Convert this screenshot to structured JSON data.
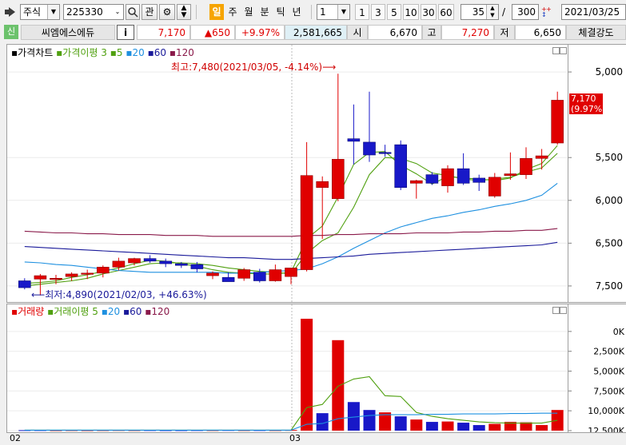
{
  "toolbar": {
    "market_type": "주식",
    "stock_code": "225330",
    "watch_label": "관",
    "period_buttons": [
      "일",
      "주",
      "월",
      "분",
      "틱",
      "년"
    ],
    "interval_value": "1",
    "interval_presets": [
      "1",
      "3",
      "5",
      "10",
      "30",
      "60"
    ],
    "zoom_count": "35",
    "zoom_total": "300",
    "date": "2021/03/25"
  },
  "quote": {
    "badge": "신",
    "name": "씨엠에스에듀",
    "info_label": "i",
    "price": "7,170",
    "change": "▲650",
    "change_pct": "+9.97%",
    "volume": "2,581,665",
    "open_label": "시",
    "open": "6,670",
    "high_label": "고",
    "high": "7,270",
    "low_label": "저",
    "low": "6,650",
    "strength_label": "체결강도"
  },
  "price_panel": {
    "legend": {
      "chart_label": "가격차트",
      "ma_label": "가격이평",
      "ma_periods": [
        "3",
        "5",
        "20",
        "60",
        "120"
      ]
    },
    "high_note": "최고:7,480(2021/03/05, -4.14%)⟶",
    "low_note": "⟵최저:4,890(2021/02/03, +46.63%)",
    "current_box": [
      "7,170",
      "(9.97%)"
    ],
    "y_ticks": [
      "7,500",
      "6,500",
      "6,000",
      "5,500",
      "5,000"
    ]
  },
  "volume_panel": {
    "legend": {
      "chart_label": "거래량",
      "ma_label": "거래이평",
      "ma_periods": [
        "5",
        "20",
        "60",
        "120"
      ]
    },
    "y_ticks": [
      "12,500K",
      "10,000K",
      "7,500K",
      "5,000K",
      "2,500K",
      "0K"
    ]
  },
  "x_labels": [
    "02",
    "03"
  ],
  "colors": {
    "up": "#e00000",
    "down": "#1818c8",
    "ma3": "#50a010",
    "ma5": "#50a010",
    "ma20": "#1e90e0",
    "ma60": "#1a1a9a",
    "ma120": "#8a1a4a",
    "period_active": "#f6a400"
  },
  "chart_data": [
    {
      "type": "candlestick",
      "title": "가격차트",
      "ylim": [
        4850,
        7650
      ],
      "y_ticks": [
        5000,
        5500,
        6000,
        6500,
        7500
      ],
      "x_label_positions": {
        "02": 0,
        "03": 17
      },
      "candles": [
        {
          "o": 5060,
          "h": 5090,
          "l": 4960,
          "c": 4980
        },
        {
          "o": 5080,
          "h": 5140,
          "l": 4890,
          "c": 5120
        },
        {
          "o": 5080,
          "h": 5130,
          "l": 5020,
          "c": 5090
        },
        {
          "o": 5110,
          "h": 5160,
          "l": 5060,
          "c": 5140
        },
        {
          "o": 5140,
          "h": 5190,
          "l": 5080,
          "c": 5150
        },
        {
          "o": 5150,
          "h": 5240,
          "l": 5100,
          "c": 5220
        },
        {
          "o": 5220,
          "h": 5330,
          "l": 5180,
          "c": 5290
        },
        {
          "o": 5270,
          "h": 5330,
          "l": 5240,
          "c": 5320
        },
        {
          "o": 5320,
          "h": 5360,
          "l": 5270,
          "c": 5290
        },
        {
          "o": 5290,
          "h": 5320,
          "l": 5220,
          "c": 5260
        },
        {
          "o": 5260,
          "h": 5280,
          "l": 5210,
          "c": 5240
        },
        {
          "o": 5250,
          "h": 5280,
          "l": 5160,
          "c": 5200
        },
        {
          "o": 5120,
          "h": 5170,
          "l": 5080,
          "c": 5150
        },
        {
          "o": 5100,
          "h": 5160,
          "l": 5050,
          "c": 5050
        },
        {
          "o": 5090,
          "h": 5210,
          "l": 5060,
          "c": 5190
        },
        {
          "o": 5160,
          "h": 5200,
          "l": 5040,
          "c": 5060
        },
        {
          "o": 5060,
          "h": 5250,
          "l": 5050,
          "c": 5190
        },
        {
          "o": 5110,
          "h": 5170,
          "l": 5020,
          "c": 5210
        },
        {
          "o": 5190,
          "h": 6680,
          "l": 5170,
          "c": 6290
        },
        {
          "o": 6150,
          "h": 6280,
          "l": 5550,
          "c": 6220
        },
        {
          "o": 6020,
          "h": 7480,
          "l": 5990,
          "c": 6480
        },
        {
          "o": 6720,
          "h": 7120,
          "l": 6420,
          "c": 6690
        },
        {
          "o": 6680,
          "h": 7270,
          "l": 6450,
          "c": 6530
        },
        {
          "o": 6560,
          "h": 6650,
          "l": 6510,
          "c": 6550
        },
        {
          "o": 6650,
          "h": 6700,
          "l": 6120,
          "c": 6150
        },
        {
          "o": 6200,
          "h": 6240,
          "l": 6020,
          "c": 6230
        },
        {
          "o": 6300,
          "h": 6330,
          "l": 6180,
          "c": 6200
        },
        {
          "o": 6170,
          "h": 6410,
          "l": 6090,
          "c": 6370
        },
        {
          "o": 6370,
          "h": 6550,
          "l": 6180,
          "c": 6200
        },
        {
          "o": 6260,
          "h": 6300,
          "l": 6110,
          "c": 6210
        },
        {
          "o": 6050,
          "h": 6320,
          "l": 6030,
          "c": 6270
        },
        {
          "o": 6290,
          "h": 6560,
          "l": 6240,
          "c": 6310
        },
        {
          "o": 6300,
          "h": 6620,
          "l": 6250,
          "c": 6490
        },
        {
          "o": 6490,
          "h": 6600,
          "l": 6360,
          "c": 6520
        },
        {
          "o": 6670,
          "h": 7270,
          "l": 6650,
          "c": 7170
        }
      ],
      "series": [
        {
          "name": "3",
          "values": [
            5030,
            5040,
            5060,
            5100,
            5130,
            5170,
            5210,
            5260,
            5300,
            5290,
            5260,
            5230,
            5190,
            5160,
            5150,
            5140,
            5140,
            5160,
            5550,
            5700,
            6040,
            6420,
            6560,
            6570,
            6410,
            6310,
            6190,
            6280,
            6260,
            6250,
            6230,
            6260,
            6360,
            6430,
            6640
          ]
        },
        {
          "name": "5",
          "values": [
            5000,
            5020,
            5040,
            5060,
            5090,
            5140,
            5180,
            5220,
            5260,
            5270,
            5270,
            5260,
            5240,
            5210,
            5190,
            5170,
            5160,
            5140,
            5380,
            5530,
            5620,
            5920,
            6300,
            6500,
            6490,
            6430,
            6320,
            6290,
            6250,
            6230,
            6250,
            6270,
            6330,
            6380,
            6550
          ]
        },
        {
          "name": "20",
          "values": [
            5280,
            5270,
            5250,
            5240,
            5220,
            5200,
            5180,
            5170,
            5160,
            5160,
            5160,
            5160,
            5160,
            5150,
            5150,
            5160,
            5170,
            5180,
            5200,
            5260,
            5340,
            5440,
            5530,
            5620,
            5690,
            5740,
            5790,
            5820,
            5860,
            5890,
            5930,
            5960,
            6000,
            6060,
            6200
          ]
        },
        {
          "name": "60",
          "values": [
            5460,
            5450,
            5440,
            5430,
            5420,
            5410,
            5400,
            5390,
            5380,
            5370,
            5360,
            5350,
            5340,
            5330,
            5330,
            5320,
            5310,
            5310,
            5320,
            5330,
            5340,
            5350,
            5370,
            5380,
            5390,
            5400,
            5410,
            5420,
            5430,
            5440,
            5450,
            5460,
            5470,
            5480,
            5510
          ]
        },
        {
          "name": "120",
          "values": [
            5640,
            5630,
            5620,
            5620,
            5610,
            5610,
            5600,
            5600,
            5600,
            5590,
            5590,
            5590,
            5580,
            5580,
            5580,
            5580,
            5580,
            5580,
            5590,
            5590,
            5600,
            5600,
            5610,
            5610,
            5610,
            5620,
            5620,
            5620,
            5630,
            5630,
            5640,
            5640,
            5650,
            5650,
            5670
          ]
        }
      ]
    },
    {
      "type": "bar",
      "title": "거래량",
      "ylabel": "K",
      "ylim": [
        0,
        14500
      ],
      "y_ticks": [
        0,
        2500,
        5000,
        7500,
        10000,
        12500
      ],
      "values": [
        60,
        60,
        50,
        60,
        50,
        60,
        70,
        60,
        60,
        50,
        50,
        60,
        60,
        70,
        60,
        60,
        60,
        80,
        14100,
        2200,
        11400,
        3600,
        2600,
        2300,
        1800,
        1400,
        1100,
        1150,
        1000,
        700,
        850,
        1100,
        1050,
        700,
        2600
      ],
      "directions": [
        "down",
        "down",
        "up",
        "up",
        "up",
        "up",
        "up",
        "up",
        "down",
        "down",
        "down",
        "down",
        "up",
        "down",
        "up",
        "down",
        "up",
        "up",
        "up",
        "down",
        "up",
        "down",
        "down",
        "up",
        "down",
        "up",
        "down",
        "up",
        "down",
        "down",
        "up",
        "up",
        "up",
        "up",
        "up"
      ],
      "series": [
        {
          "name": "5",
          "values": [
            60,
            60,
            60,
            60,
            60,
            60,
            60,
            60,
            60,
            60,
            60,
            60,
            60,
            60,
            60,
            60,
            60,
            60,
            2900,
            3300,
            5600,
            6500,
            6800,
            4400,
            4300,
            2300,
            1800,
            1500,
            1300,
            1100,
            1000,
            950,
            950,
            950,
            1300
          ]
        },
        {
          "name": "20",
          "values": [
            60,
            60,
            60,
            60,
            60,
            60,
            60,
            60,
            60,
            60,
            60,
            60,
            60,
            60,
            60,
            60,
            60,
            60,
            800,
            900,
            1500,
            1700,
            1900,
            2000,
            2000,
            2000,
            2050,
            2050,
            2100,
            2100,
            2100,
            2150,
            2150,
            2200,
            2200
          ]
        }
      ]
    }
  ]
}
